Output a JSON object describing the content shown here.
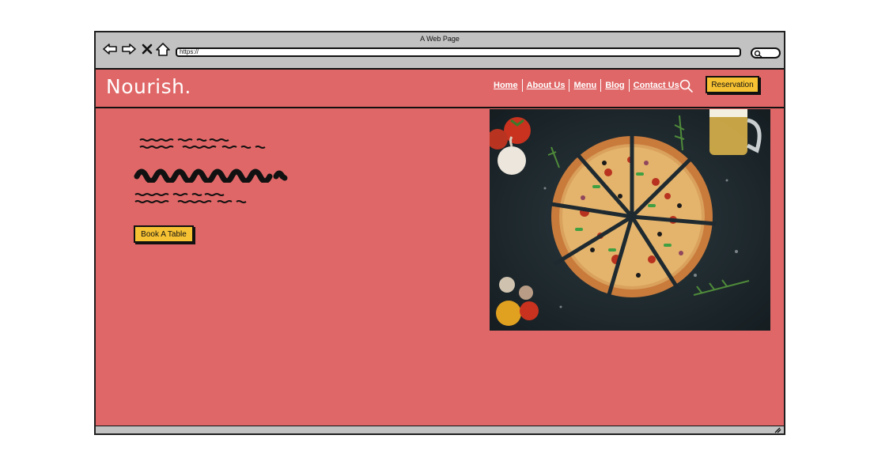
{
  "window": {
    "title": "A Web Page",
    "url": "https://"
  },
  "site": {
    "logo": "Nourish.",
    "nav": [
      {
        "label": "Home"
      },
      {
        "label": "About Us"
      },
      {
        "label": "Menu"
      },
      {
        "label": "Blog"
      },
      {
        "label": "Contact Us"
      }
    ],
    "reservation_label": "Reservation"
  },
  "hero": {
    "cta_label": "Book A Table",
    "image_icon": "pizza-photo",
    "text_placeholder": "scribble"
  },
  "colors": {
    "page_bg": "#e06767",
    "accent_button": "#f6c132",
    "chrome": "#c2c2c2"
  }
}
